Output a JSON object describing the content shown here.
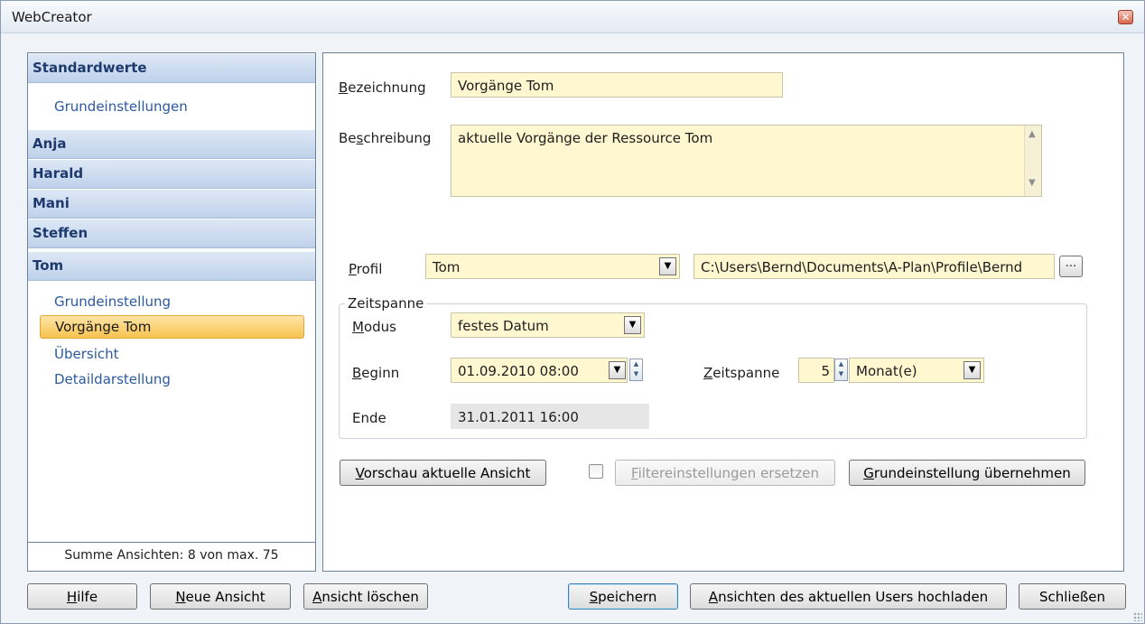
{
  "window": {
    "title": "WebCreator",
    "close_icon": "✕"
  },
  "sidebar": {
    "groups": [
      {
        "label": "Standardwerte",
        "items": [
          "Grundeinstellungen"
        ]
      },
      {
        "label": "Anja"
      },
      {
        "label": "Harald"
      },
      {
        "label": "Mani"
      },
      {
        "label": "Steffen"
      },
      {
        "label": "Tom",
        "items": [
          "Grundeinstellung",
          "Vorgänge Tom",
          "Übersicht",
          "Detaildarstellung"
        ],
        "selected": "Vorgänge Tom"
      }
    ],
    "summary": "Summe Ansichten: 8 von max. 75"
  },
  "form": {
    "bezeichnung_label": "Bezeichnung",
    "bezeichnung_value": "Vorgänge Tom",
    "beschreibung_label": "Beschreibung",
    "beschreibung_value": "aktuelle Vorgänge der Ressource Tom",
    "profil_label": "Profil",
    "profil_value": "Tom",
    "profil_path": "C:\\Users\\Bernd\\Documents\\A-Plan\\Profile\\Bernd",
    "browse_label": "...",
    "zeitspanne_group_title": "Zeitspanne",
    "modus_label": "Modus",
    "modus_value": "festes Datum",
    "beginn_label": "Beginn",
    "beginn_value": "01.09.2010 08:00",
    "zeitspanne_label": "Zeitspanne",
    "zeitspanne_count": "5",
    "zeitspanne_unit": "Monat(e)",
    "ende_label": "Ende",
    "ende_value": "31.01.2011 16:00",
    "vorschau_button": "Vorschau aktuelle Ansicht",
    "filter_checkbox_label": "Filtereinstellungen ersetzen",
    "filter_checked": false,
    "grundeinstellung_button": "Grundeinstellung übernehmen"
  },
  "footer": {
    "hilfe": "Hilfe",
    "neue_ansicht": "Neue Ansicht",
    "ansicht_loeschen": "Ansicht löschen",
    "speichern": "Speichern",
    "hochladen": "Ansichten des aktuellen Users hochladen",
    "schliessen": "Schließen"
  },
  "colors": {
    "accent": "#1e3a6d",
    "field_bg": "#fff7cf",
    "selected_bg": "#f7c350",
    "link": "#2b5aa0"
  }
}
